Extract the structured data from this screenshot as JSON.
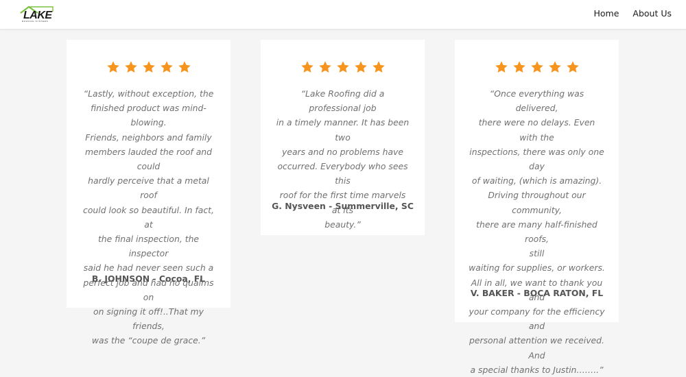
{
  "header": {
    "logo": {
      "name": "LAKE",
      "tagline": "ROOFING SYSTEMS"
    },
    "nav": [
      {
        "label": "Home"
      },
      {
        "label": "About Us"
      }
    ]
  },
  "colors": {
    "star": "#f7941d",
    "logo_roof": "#7cc242"
  },
  "testimonials": [
    {
      "rating": 5,
      "quote": "“Lastly, without exception, the\nfinished product was mind-blowing.\nFriends, neighbors and family\nmembers lauded the roof and could\nhardly perceive that a metal roof\ncould look so beautiful. In fact, at\nthe final inspection, the inspector\nsaid he had never seen such a\nperfect job and had no qualms on\non signing it off!..That my friends,\nwas the “coupe de grace.”",
      "author": "B. JOHNSON - Cocoa, FL"
    },
    {
      "rating": 5,
      "quote": "“Lake Roofing did a professional job\nin a timely manner. It has been two\nyears and no problems have\noccurred. Everybody who sees this\nroof for the first time marvels at its\nbeauty.”",
      "author": "G. Nysveen - Summerville, SC"
    },
    {
      "rating": 5,
      "quote": "“Once everything was delivered,\nthere were no delays. Even with the\ninspections, there was only one day\nof waiting, (which is amazing).\nDriving throughout our community,\nthere are many half-finished roofs,\nstill\nwaiting for supplies, or workers.\nAll in all, we want to thank you and\nyour company for the efficiency and\npersonal attention we received. And\na special thanks to Justin……..”",
      "author": "V. BAKER - BOCA RATON, FL"
    }
  ]
}
